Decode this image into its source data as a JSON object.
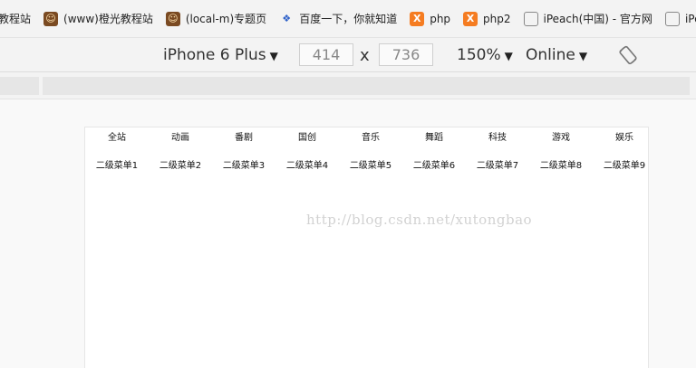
{
  "bookmarks": [
    {
      "icon": "none",
      "label": "教程站"
    },
    {
      "icon": "face-icon",
      "label": "(www)橙光教程站"
    },
    {
      "icon": "face-icon",
      "label": "(local-m)专题页"
    },
    {
      "icon": "paw-icon",
      "label": "百度一下，你就知道"
    },
    {
      "icon": "xampp-icon",
      "label": "php"
    },
    {
      "icon": "xampp-icon",
      "label": "php2"
    },
    {
      "icon": "globe-icon",
      "label": "iPeach(中国) - 官方网"
    },
    {
      "icon": "globe-icon",
      "label": "iPea"
    }
  ],
  "device_toolbar": {
    "device": "iPhone 6 Plus",
    "width": "414",
    "times": "x",
    "height": "736",
    "zoom": "150%",
    "network": "Online",
    "caret": "▼"
  },
  "page": {
    "nav_primary": [
      "全站",
      "动画",
      "番剧",
      "国创",
      "音乐",
      "舞蹈",
      "科技",
      "游戏",
      "娱乐"
    ],
    "nav_secondary": [
      "二级菜单1",
      "二级菜单2",
      "二级菜单3",
      "二级菜单4",
      "二级菜单5",
      "二级菜单6",
      "二级菜单7",
      "二级菜单8",
      "二级菜单9"
    ],
    "watermark": "http://blog.csdn.net/xutongbao"
  },
  "colors": {
    "toolbar_bg": "#f3f3f3",
    "xampp_orange": "#f57c21",
    "baidu_blue": "#2f62c9",
    "watermark": "#d2d2d2"
  }
}
